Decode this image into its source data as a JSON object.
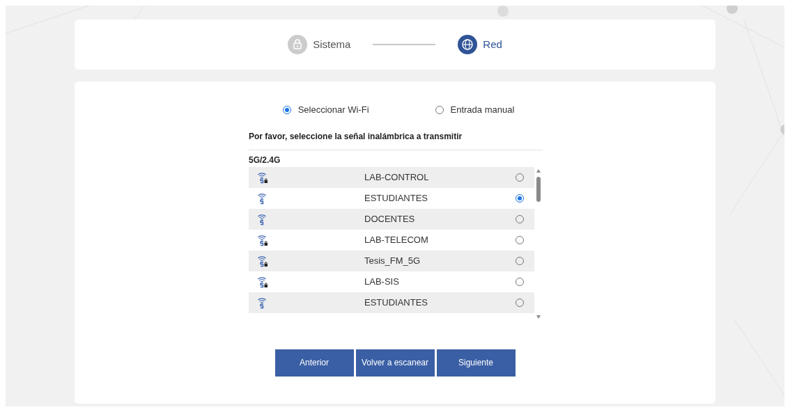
{
  "steps": [
    {
      "label": "Sistema",
      "kind": "lock",
      "active": false
    },
    {
      "label": "Red",
      "kind": "globe",
      "active": true
    }
  ],
  "modes": [
    {
      "label": "Seleccionar Wi-Fi",
      "selected": true
    },
    {
      "label": "Entrada manual",
      "selected": false
    }
  ],
  "prompt": "Por favor, seleccione la señal inalámbrica a transmitir",
  "band_header": "5G/2.4G",
  "networks": [
    {
      "ssid": "LAB-CONTROL",
      "locked": true,
      "selected": false
    },
    {
      "ssid": "ESTUDIANTES",
      "locked": false,
      "selected": true
    },
    {
      "ssid": "DOCENTES",
      "locked": false,
      "selected": false
    },
    {
      "ssid": "LAB-TELECOM",
      "locked": true,
      "selected": false
    },
    {
      "ssid": "Tesis_FM_5G",
      "locked": true,
      "selected": false
    },
    {
      "ssid": "LAB-SIS",
      "locked": true,
      "selected": false
    },
    {
      "ssid": "ESTUDIANTES",
      "locked": false,
      "selected": false
    }
  ],
  "buttons": [
    "Anterior",
    "Volver a escanear",
    "Siguiente"
  ]
}
